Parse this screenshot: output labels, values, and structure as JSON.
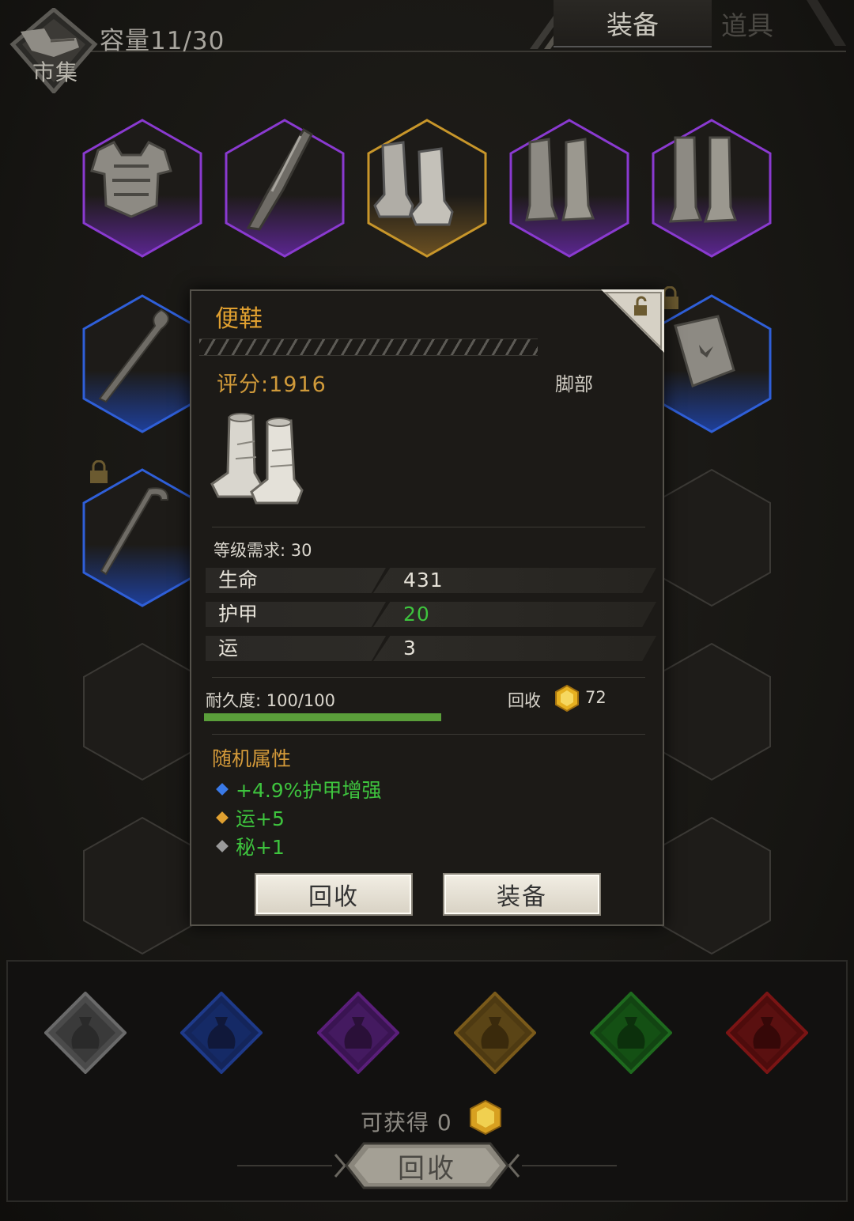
{
  "header": {
    "market_label": "市集",
    "capacity": "容量11/30",
    "tab_equipment": "装备",
    "tab_items": "道具"
  },
  "inventory": {
    "rarity_colors": {
      "purple": "#8a3ad0",
      "gold": "#c8962a",
      "blue": "#2f5fd8",
      "empty": "#3b3935"
    },
    "slots": [
      {
        "icon": "armor-chest-icon",
        "rarity": "purple",
        "locked": false
      },
      {
        "icon": "dagger-icon",
        "rarity": "purple",
        "locked": false
      },
      {
        "icon": "boots-icon",
        "rarity": "gold",
        "locked": false
      },
      {
        "icon": "greaves-icon",
        "rarity": "purple",
        "locked": false
      },
      {
        "icon": "leg-armor-icon",
        "rarity": "purple",
        "locked": false
      },
      {
        "icon": "staff-icon",
        "rarity": "blue",
        "locked": false
      },
      {
        "icon": "tome-icon",
        "rarity": "blue",
        "locked": true
      },
      {
        "icon": "cane-icon",
        "rarity": "blue",
        "locked": true
      }
    ]
  },
  "popup": {
    "name": "便鞋",
    "score": "评分:1916",
    "slot": "脚部",
    "level_req": "等级需求: 30",
    "stats": [
      {
        "name": "生命",
        "value": "431",
        "color": "#e6e2d8"
      },
      {
        "name": "护甲",
        "value": "20",
        "color": "#3ec43e"
      },
      {
        "name": "运",
        "value": "3",
        "color": "#e6e2d8"
      }
    ],
    "durability": "耐久度: 100/100",
    "durability_fraction": 1.0,
    "recycle_label": "回收",
    "recycle_value": "72",
    "random_title": "随机属性",
    "random_attrs": [
      {
        "text": "+4.9%护甲增强",
        "dot_color": "#3a7ae8"
      },
      {
        "text": "运+5",
        "dot_color": "#e0a030"
      },
      {
        "text": "秘+1",
        "dot_color": "#9a9a9a"
      }
    ],
    "btn_recycle": "回收",
    "btn_equip": "装备"
  },
  "bottom": {
    "bags": [
      {
        "color": "#6a6a6a",
        "name": "gray-bag"
      },
      {
        "color": "#1e3a8a",
        "name": "blue-bag"
      },
      {
        "color": "#5a1e7a",
        "name": "purple-bag"
      },
      {
        "color": "#7a5a1a",
        "name": "gold-bag"
      },
      {
        "color": "#1e6a1e",
        "name": "green-bag"
      },
      {
        "color": "#7a1414",
        "name": "red-bag"
      }
    ],
    "obtain_text": "可获得 0",
    "recycle_button": "回收"
  }
}
